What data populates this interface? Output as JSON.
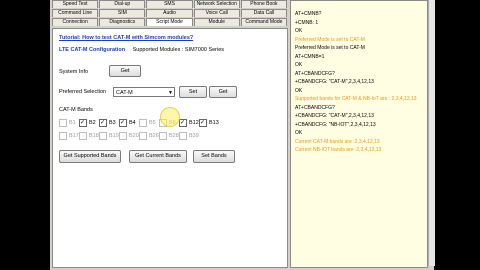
{
  "tabs": {
    "row1": [
      "Speed Test",
      "Dial-up",
      "SMS",
      "Network Selection",
      "Phone Book"
    ],
    "row2": [
      "Command Line",
      "SIM",
      "Audio",
      "Voice Call",
      "Data Call"
    ],
    "row3": [
      "Connection",
      "Diagnostics",
      "Script Mode",
      "Module",
      "Command Mode"
    ]
  },
  "main": {
    "tutorial_link": "Tutorial: How to test CAT-M with Simcom modules?",
    "title": "LTE CAT-M Configuration",
    "supported": "Supported Modules : SIM7000 Series",
    "system_info_label": "System Info",
    "get_label": "Get",
    "preferred_label": "Preferred Selection",
    "preferred_value": "CAT-M",
    "set_label": "Set",
    "bands_label": "CAT-M Bands",
    "bands": [
      {
        "name": "B1",
        "checked": false,
        "enabled": false
      },
      {
        "name": "B2",
        "checked": true,
        "enabled": true
      },
      {
        "name": "B3",
        "checked": true,
        "enabled": true
      },
      {
        "name": "B4",
        "checked": true,
        "enabled": true
      },
      {
        "name": "B5",
        "checked": false,
        "enabled": false
      },
      {
        "name": "B8",
        "checked": false,
        "enabled": false
      },
      {
        "name": "B12",
        "checked": true,
        "enabled": true
      },
      {
        "name": "B13",
        "checked": true,
        "enabled": true
      },
      {
        "name": "B17",
        "checked": false,
        "enabled": false
      },
      {
        "name": "B18",
        "checked": false,
        "enabled": false
      },
      {
        "name": "B19",
        "checked": false,
        "enabled": false
      },
      {
        "name": "B20",
        "checked": false,
        "enabled": false
      },
      {
        "name": "B26",
        "checked": false,
        "enabled": false
      },
      {
        "name": "B28",
        "checked": false,
        "enabled": false
      },
      {
        "name": "B39",
        "checked": false,
        "enabled": false
      }
    ],
    "btn_supported": "Get Supported Bands",
    "btn_current": "Get Current Bands",
    "btn_set": "Set Bands"
  },
  "console": [
    {
      "text": "AT+CMNB?",
      "hl": false
    },
    {
      "text": "+CMNB: 1",
      "hl": false
    },
    {
      "text": "OK",
      "hl": false
    },
    {
      "text": "Preferred Mode is set to CAT-M",
      "hl": true
    },
    {
      "text": "Preferred Mode is set to CAT-M",
      "hl": false
    },
    {
      "text": "AT+CMNB=1",
      "hl": false
    },
    {
      "text": "OK",
      "hl": false
    },
    {
      "text": "AT+CBANDCFG?",
      "hl": false
    },
    {
      "text": "+CBANDCFG: \"CAT-M\",2,3,4,12,13",
      "hl": false
    },
    {
      "text": "OK",
      "hl": false
    },
    {
      "text": "Supported bands for CAT-M & NB-IoT are : 2,3,4,12,13",
      "hl": true
    },
    {
      "text": "AT+CBANDCFG?",
      "hl": false
    },
    {
      "text": "+CBANDCFG: \"CAT-M\",2,3,4,12,13",
      "hl": false
    },
    {
      "text": "+CBANDCFG: \"NB-IOT\",2,3,4,12,13",
      "hl": false
    },
    {
      "text": "OK",
      "hl": false
    },
    {
      "text": "Current CAT-M bands are :2,3,4,12,13",
      "hl": true
    },
    {
      "text": "Current NB-IOT bands are :2,3,4,12,13",
      "hl": true
    }
  ]
}
